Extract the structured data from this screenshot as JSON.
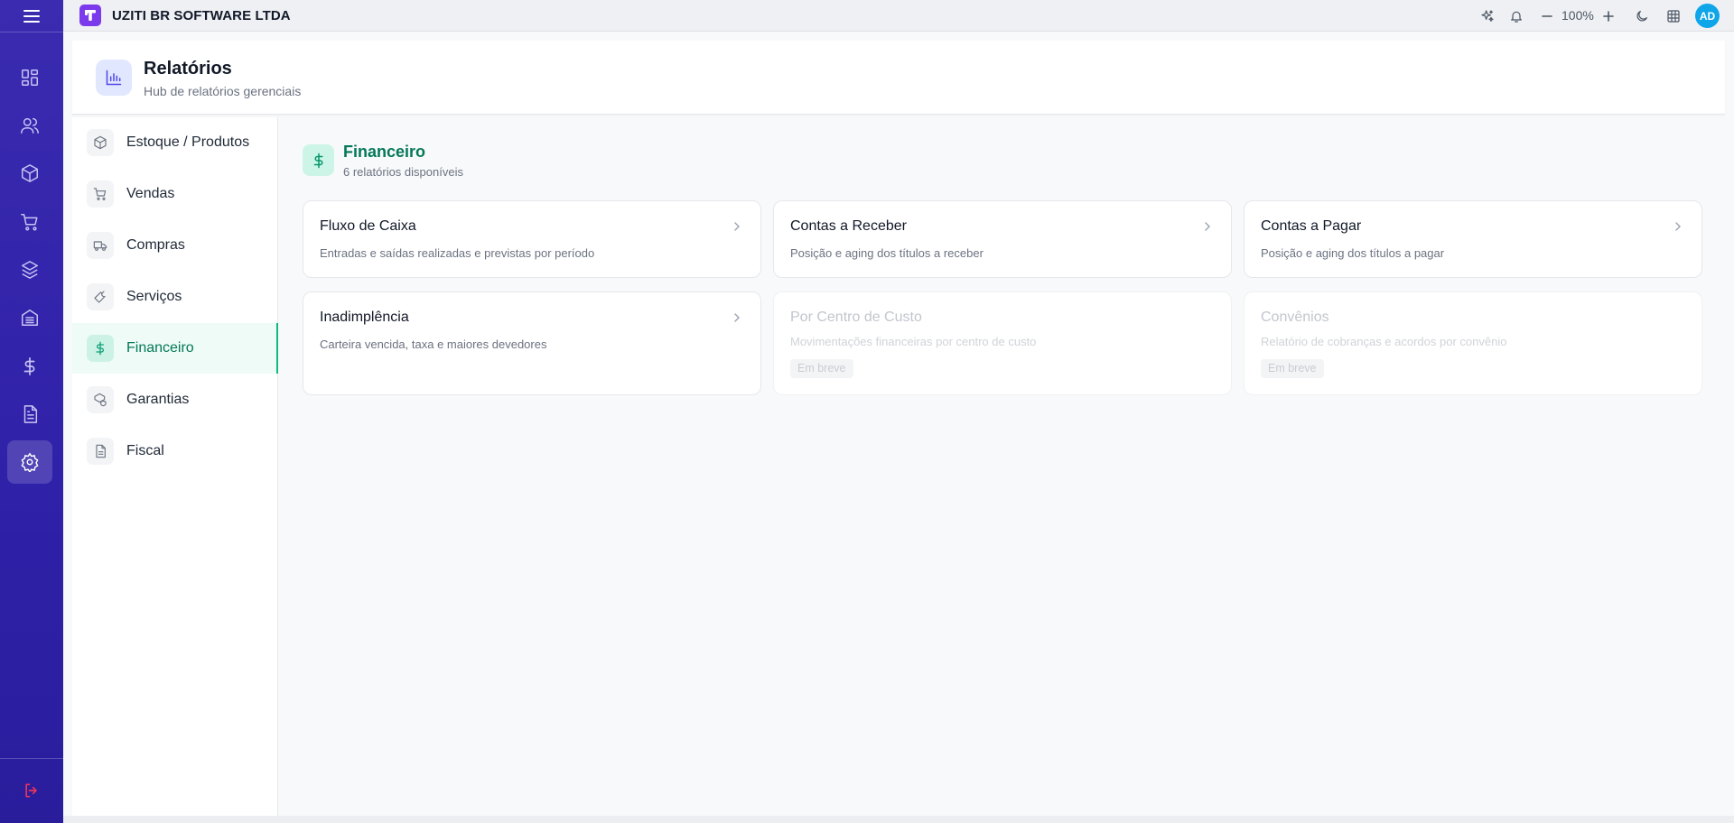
{
  "company": {
    "name": "UZITI BR SOFTWARE LTDA"
  },
  "topbar": {
    "zoom": "100%",
    "avatar_initials": "AD"
  },
  "page": {
    "title": "Relatórios",
    "subtitle": "Hub de relatórios gerenciais"
  },
  "rail": {
    "items": [
      "dashboard-icon",
      "users-icon",
      "box-icon",
      "cart-icon",
      "layers-icon",
      "bank-icon",
      "dollar-icon",
      "document-icon",
      "gear-icon"
    ],
    "active": "gear-icon"
  },
  "categories": [
    {
      "label": "Estoque / Produtos",
      "icon": "box-icon"
    },
    {
      "label": "Vendas",
      "icon": "cart-icon"
    },
    {
      "label": "Compras",
      "icon": "truck-icon"
    },
    {
      "label": "Serviços",
      "icon": "wrench-icon"
    },
    {
      "label": "Financeiro",
      "icon": "dollar-icon",
      "active": true
    },
    {
      "label": "Garantias",
      "icon": "shield-box-icon"
    },
    {
      "label": "Fiscal",
      "icon": "document-icon"
    }
  ],
  "section": {
    "title": "Financeiro",
    "count_text": "6 relatórios disponíveis"
  },
  "reports": [
    {
      "title": "Fluxo de Caixa",
      "description": "Entradas e saídas realizadas e previstas por período"
    },
    {
      "title": "Contas a Receber",
      "description": "Posição e aging dos títulos a receber"
    },
    {
      "title": "Contas a Pagar",
      "description": "Posição e aging dos títulos a pagar"
    },
    {
      "title": "Inadimplência",
      "description": "Carteira vencida, taxa e maiores devedores"
    },
    {
      "title": "Por Centro de Custo",
      "description": "Movimentações financeiras por centro de custo",
      "badge": "Em breve"
    },
    {
      "title": "Convênios",
      "description": "Relatório de cobranças e acordos por convênio",
      "badge": "Em breve"
    }
  ],
  "colors": {
    "rail": "#3a2bb0",
    "accent_green": "#047857",
    "brand": "#7c3aed"
  }
}
